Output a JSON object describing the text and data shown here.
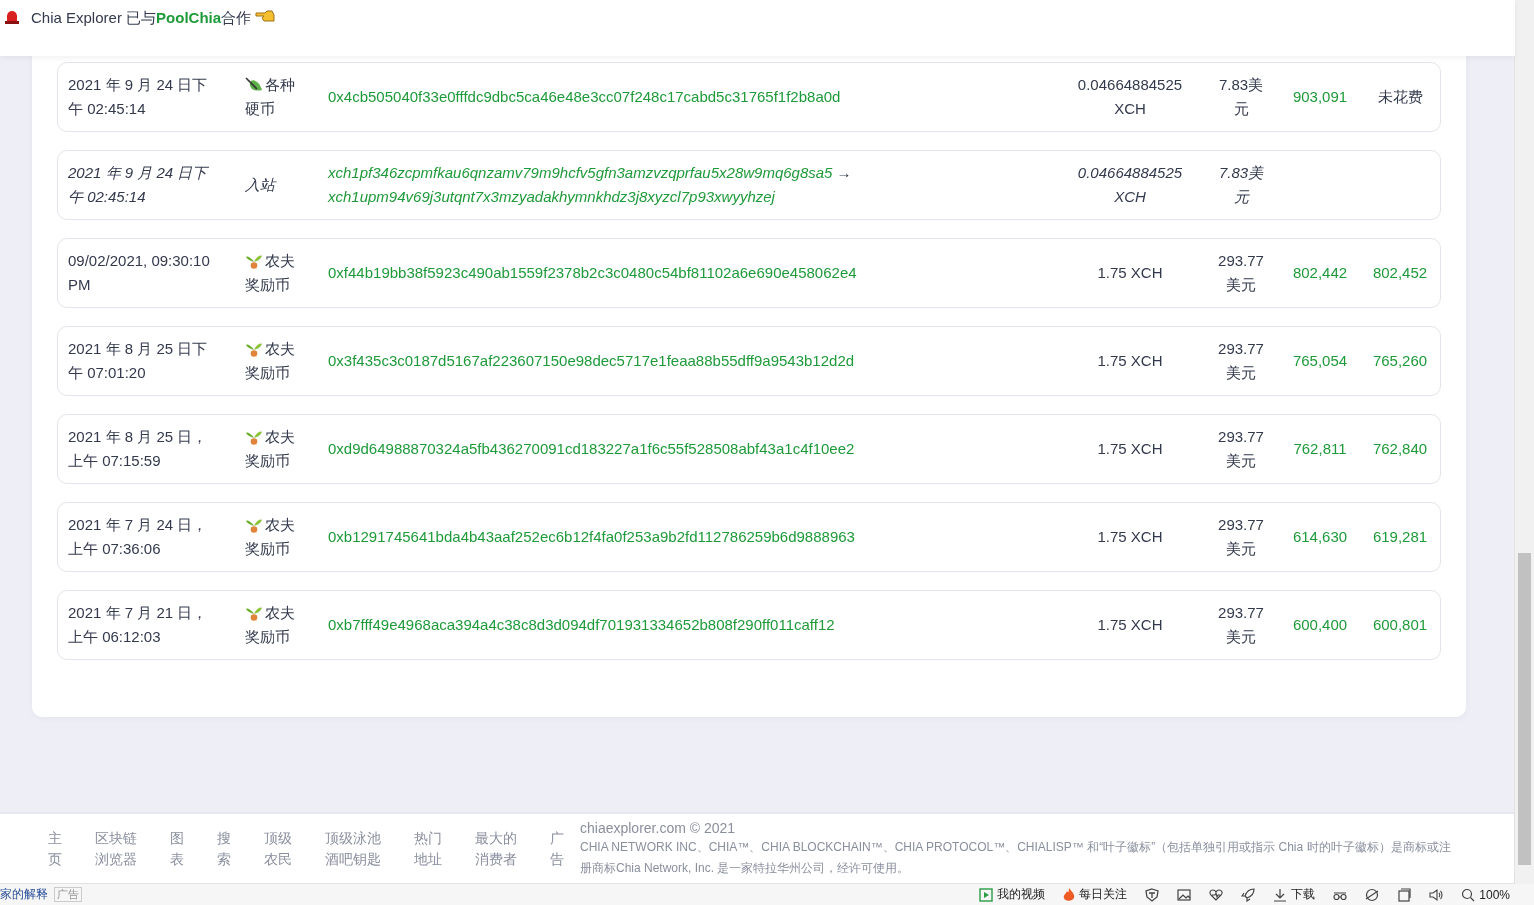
{
  "banner": {
    "text": "Chia Explorer 已与**PoolChia**合作"
  },
  "rows": [
    {
      "kind": "coin",
      "date": "2021 年 9 月 24 日下午 02:45:14",
      "type": [
        "各种",
        "硬币"
      ],
      "hash": "0x4cb505040f33e0fffdc9dbc5ca46e48e3cc07f248c17cabd5c31765f1f2b8a0d",
      "amount": "0.04664884525 XCH",
      "usd": "7.83美元",
      "confirmed": "903,091",
      "spent": "未花费",
      "unspent": true
    },
    {
      "kind": "incoming",
      "date": "2021 年 9 月 24 日下午 02:45:14",
      "type": [
        "入站"
      ],
      "from": "xch1pf346zcpmfkau6qnzamv79m9hcfv5gfn3amzvzqprfau5x28w9mq6g8sa5",
      "arrow": "→",
      "to": "xch1upm94v69j3utqnt7x3mzyadakhymnkhdz3j8xyzcl7p93xwyyhzej",
      "amount": "0.04664884525 XCH",
      "usd": "7.83美元"
    },
    {
      "kind": "reward",
      "date": "09/02/2021, 09:30:10 PM",
      "type": [
        "农夫",
        "奖励币"
      ],
      "hash": "0xf44b19bb38f5923c490ab1559f2378b2c3c0480c54bf81102a6e690e458062e4",
      "amount": "1.75 XCH",
      "usd": "293.77 美元",
      "confirmed": "802,442",
      "spent": "802,452",
      "unspent": false
    },
    {
      "kind": "reward",
      "date": "2021 年 8 月 25 日下午 07:01:20",
      "type": [
        "农夫",
        "奖励币"
      ],
      "hash": "0x3f435c3c0187d5167af223607150e98dec5717e1feaa88b55dff9a9543b12d2d",
      "amount": "1.75 XCH",
      "usd": "293.77 美元",
      "confirmed": "765,054",
      "spent": "765,260",
      "unspent": false
    },
    {
      "kind": "reward",
      "date": "2021 年 8 月 25 日，上午 07:15:59",
      "type": [
        "农夫",
        "奖励币"
      ],
      "hash": "0xd9d64988870324a5fb436270091cd183227a1f6c55f528508abf43a1c4f10ee2",
      "amount": "1.75 XCH",
      "usd": "293.77 美元",
      "confirmed": "762,811",
      "spent": "762,840",
      "unspent": false
    },
    {
      "kind": "reward",
      "date": "2021 年 7 月 24 日，上午 07:36:06",
      "type": [
        "农夫",
        "奖励币"
      ],
      "hash": "0xb1291745641bda4b43aaf252ec6b12f4fa0f253a9b2fd112786259b6d9888963",
      "amount": "1.75 XCH",
      "usd": "293.77 美元",
      "confirmed": "614,630",
      "spent": "619,281",
      "unspent": false
    },
    {
      "kind": "reward",
      "date": "2021 年 7 月 21 日，上午 06:12:03",
      "type": [
        "农夫",
        "奖励币"
      ],
      "hash": "0xb7fff49e4968aca394a4c38c8d3d094df701931334652b808f290ff011caff12",
      "amount": "1.75 XCH",
      "usd": "293.77 美元",
      "confirmed": "600,400",
      "spent": "600,801",
      "unspent": false
    }
  ],
  "footer": {
    "nav": [
      "主页",
      "区块链浏览器",
      "图表",
      "搜索",
      "顶级农民",
      "顶级泳池酒吧钥匙",
      "热门地址",
      "最大的消费者",
      "广告"
    ],
    "copyright": "chiaexplorer.com © 2021",
    "legal": "CHIA NETWORK INC、CHIA™、CHIA BLOCKCHAIN™、CHIA PROTOCOL™、CHIALISP™ 和“叶子徽标”（包括单独引用或指示 Chia 时的叶子徽标）是商标或注册商标Chia Network, Inc. 是一家特拉华州公司，经许可使用。"
  },
  "status_bar": {
    "left_link": "家的解释",
    "ad_badge": "广告",
    "items": [
      {
        "kind": "video",
        "label": "我的视频"
      },
      {
        "kind": "feed",
        "label": "每日关注"
      },
      {
        "kind": "shield"
      },
      {
        "kind": "image"
      },
      {
        "kind": "health"
      },
      {
        "kind": "boost"
      },
      {
        "kind": "download",
        "label": "下载"
      },
      {
        "kind": "reader"
      },
      {
        "kind": "browser"
      },
      {
        "kind": "window"
      },
      {
        "kind": "sound"
      },
      {
        "kind": "zoom",
        "label": "100%"
      }
    ]
  }
}
